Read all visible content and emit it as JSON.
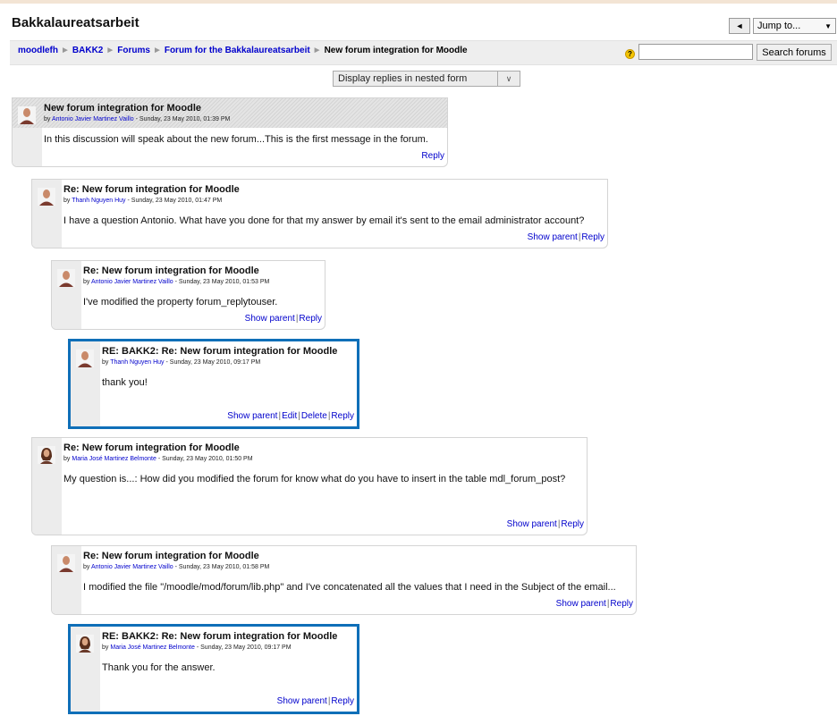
{
  "page": {
    "title": "Bakkalaureatsarbeit",
    "jump_label": "Jump to...",
    "breadcrumb": [
      "moodlefh",
      "BAKK2",
      "Forums",
      "Forum for the Bakkalaureatsarbeit"
    ],
    "breadcrumb_current": "New forum integration for Moodle",
    "search_placeholder": "",
    "search_button": "Search forums",
    "display_mode": "Display replies in nested form"
  },
  "colors": {
    "link": "#0000cc",
    "highlight_border": "#0f6fb8",
    "header_bg": "#dcdcdc",
    "navbar_bg": "#eeeeee"
  },
  "links": {
    "show_parent": "Show parent",
    "reply": "Reply",
    "edit": "Edit",
    "delete": "Delete"
  },
  "posts": [
    {
      "subject": "New forum integration for Moodle",
      "by": "by",
      "author": "Antonio Javier Martinez Vaillo",
      "date": " - Sunday, 23 May 2010, 01:39 PM",
      "message": "In this discussion will speak about the new forum...This is the first message in the forum.",
      "avatar": "male-avatar-icon"
    },
    {
      "subject": "Re: New forum integration for Moodle",
      "by": "by",
      "author": "Thanh Nguyen Huy",
      "date": " - Sunday, 23 May 2010, 01:47 PM",
      "message": "I have a question Antonio. What have you done for that my answer by email it's sent to the email administrator account?",
      "avatar": "male-avatar-icon"
    },
    {
      "subject": "Re: New forum integration for Moodle",
      "by": "by",
      "author": "Antonio Javier Martinez Vaillo",
      "date": " - Sunday, 23 May 2010, 01:53 PM",
      "message": "I've modified the property forum_replytouser.",
      "avatar": "male-avatar-icon"
    },
    {
      "subject": "RE: BAKK2: Re: New forum integration for Moodle",
      "by": "by",
      "author": "Thanh Nguyen Huy",
      "date": " - Sunday, 23 May 2010, 09:17 PM",
      "message": "thank you!",
      "avatar": "male-avatar-icon"
    },
    {
      "subject": "Re: New forum integration for Moodle",
      "by": "by",
      "author": "Maria José Martinez Belmonte",
      "date": " - Sunday, 23 May 2010, 01:50 PM",
      "message": "My question is...: How did you modified the forum for know what do you have to insert in the table mdl_forum_post?",
      "avatar": "female-avatar-icon"
    },
    {
      "subject": "Re: New forum integration for Moodle",
      "by": "by",
      "author": "Antonio Javier Martinez Vaillo",
      "date": " - Sunday, 23 May 2010, 01:58 PM",
      "message": "I modified the file \"/moodle/mod/forum/lib.php\" and I've concatenated all the values that I need in the Subject of the email...",
      "avatar": "male-avatar-icon"
    },
    {
      "subject": "RE: BAKK2: Re: New forum integration for Moodle",
      "by": "by",
      "author": "Maria José Martinez Belmonte",
      "date": " - Sunday, 23 May 2010, 09:17 PM",
      "message": "Thank you for the answer.",
      "avatar": "female-avatar-icon"
    }
  ]
}
